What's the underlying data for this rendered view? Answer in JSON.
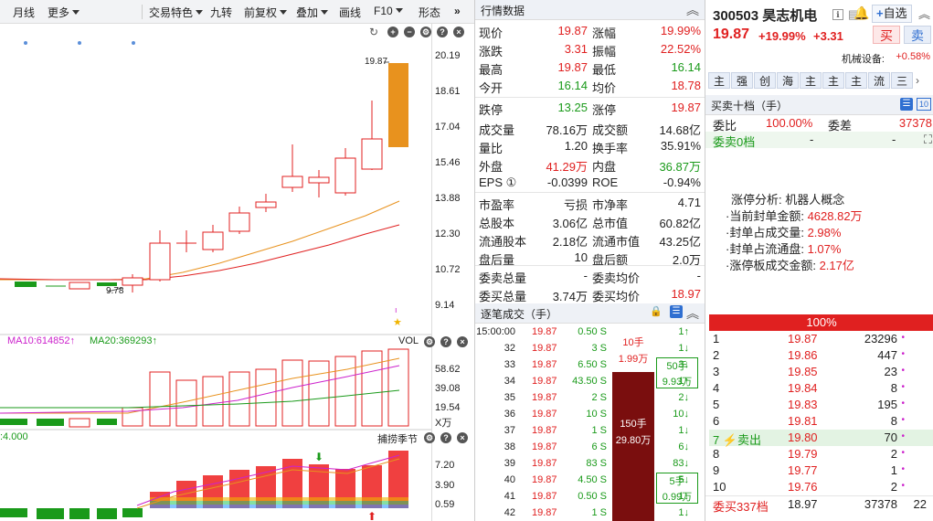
{
  "toolbar": {
    "items": [
      "月线",
      "更多",
      "交易特色",
      "九转",
      "前复权",
      "叠加",
      "画线",
      "F10",
      "形态"
    ]
  },
  "chart": {
    "price_axis": [
      "20.19",
      "18.61",
      "17.04",
      "15.46",
      "13.88",
      "12.30",
      "10.72",
      "9.14"
    ],
    "high_label": "19.87",
    "low_label": "9.78",
    "vol_header": {
      "ma10": "MA10:614852",
      "ma20": "MA20:369293",
      "title": "VOL"
    },
    "vol_axis": [
      "58.62",
      "39.08",
      "19.54"
    ],
    "vol_unit": "X万",
    "ind_header": {
      "left": ":4.000",
      "title": "捕捞季节"
    },
    "ind_axis": [
      "7.20",
      "3.90",
      "0.59"
    ],
    "colors": {
      "up": "#e02020",
      "down": "#1a9a1a",
      "today": "#e8921e",
      "ma_orange": "#e8921e",
      "ma_red": "#e02020",
      "ma_green": "#1a9a1a",
      "ma_magenta": "#cc22cc"
    }
  },
  "quote": {
    "title": "行情数据",
    "rows": [
      [
        "现价",
        "19.87",
        "涨幅",
        "19.99%"
      ],
      [
        "涨跌",
        "3.31",
        "振幅",
        "22.52%"
      ],
      [
        "最高",
        "19.87",
        "最低",
        "16.14"
      ],
      [
        "今开",
        "16.14",
        "均价",
        "18.78"
      ],
      [
        "跌停",
        "13.25",
        "涨停",
        "19.87"
      ],
      [
        "成交量",
        "78.16万",
        "成交额",
        "14.68亿"
      ],
      [
        "量比",
        "1.20",
        "换手率",
        "35.91%"
      ],
      [
        "外盘",
        "41.29万",
        "内盘",
        "36.87万"
      ],
      [
        "EPS ①",
        "-0.0399",
        "ROE",
        "-0.94%"
      ],
      [
        "市盈率",
        "亏损",
        "市净率",
        "4.71"
      ],
      [
        "总股本",
        "3.06亿",
        "总市值",
        "60.82亿"
      ],
      [
        "流通股本",
        "2.18亿",
        "流通市值",
        "43.25亿"
      ],
      [
        "盘后量",
        "10",
        "盘后额",
        "2.0万"
      ],
      [
        "委卖总量",
        "-",
        "委卖均价",
        "-"
      ],
      [
        "委买总量",
        "3.74万",
        "委买均价",
        "18.97"
      ]
    ]
  },
  "ticks": {
    "title": "逐笔成交（手）",
    "rows": [
      [
        "15:00:00",
        "19.87",
        "0.50 S",
        "10手",
        "1↑"
      ],
      [
        "32",
        "19.87",
        "3 S",
        "1.99万",
        "1↓"
      ],
      [
        "33",
        "19.87",
        "6.50 S",
        "50手",
        "3↓"
      ],
      [
        "34",
        "19.87",
        "43.50 S",
        "9.93万",
        "1↑"
      ],
      [
        "35",
        "19.87",
        "2 S",
        "",
        "2↓"
      ],
      [
        "36",
        "19.87",
        "10 S",
        "",
        "10↓"
      ],
      [
        "37",
        "19.87",
        "1 S",
        "",
        "1↓"
      ],
      [
        "38",
        "19.87",
        "6 S",
        "",
        "6↓"
      ],
      [
        "39",
        "19.87",
        "83 S",
        "",
        "83↓"
      ],
      [
        "40",
        "19.87",
        "4.50 S",
        "5手",
        "5↓"
      ],
      [
        "41",
        "19.87",
        "0.50 S",
        "0.99万",
        "1↓"
      ],
      [
        "42",
        "19.87",
        "1 S",
        "",
        "1↓"
      ]
    ],
    "big_order": {
      "vol": "150手",
      "amt": "29.80万"
    }
  },
  "stock": {
    "code_name": "300503 昊志机电",
    "price": "19.87",
    "pct": "+19.99%",
    "chg": "+3.31",
    "buy": "买",
    "sell": "卖",
    "watch": "自选",
    "sector": "机械设备:",
    "sector_pct": "+0.58%",
    "tags": [
      "主",
      "强",
      "创",
      "海",
      "主",
      "主",
      "主",
      "流",
      "三"
    ],
    "book_title": "买卖十档（手）",
    "weibi_label": "委比",
    "weibi": "100.00%",
    "weicha_label": "委差",
    "weicha": "37378",
    "ask_label": "委卖0档",
    "ask_v1": "-",
    "ask_v2": "-",
    "limit_title": "涨停分析: 机器人概念",
    "limit_items": [
      [
        "·当前封单金额: ",
        "4628.82万"
      ],
      [
        "·封单占成交量: ",
        "2.98%"
      ],
      [
        "·封单占流通盘: ",
        "1.07%"
      ],
      [
        "·涨停板成交金额: ",
        "2.17亿"
      ]
    ],
    "bar_label": "100%",
    "bids": [
      [
        "1",
        "19.87",
        "23296"
      ],
      [
        "2",
        "19.86",
        "447"
      ],
      [
        "3",
        "19.85",
        "23"
      ],
      [
        "4",
        "19.84",
        "8"
      ],
      [
        "5",
        "19.83",
        "195"
      ],
      [
        "6",
        "19.81",
        "8"
      ],
      [
        "7 ⚡卖出",
        "19.80",
        "70"
      ],
      [
        "8",
        "19.79",
        "2"
      ],
      [
        "9",
        "19.77",
        "1"
      ],
      [
        "10",
        "19.76",
        "2"
      ]
    ],
    "footer": {
      "label": "委买337档",
      "price": "18.97",
      "vol": "37378",
      "n": "22"
    }
  }
}
